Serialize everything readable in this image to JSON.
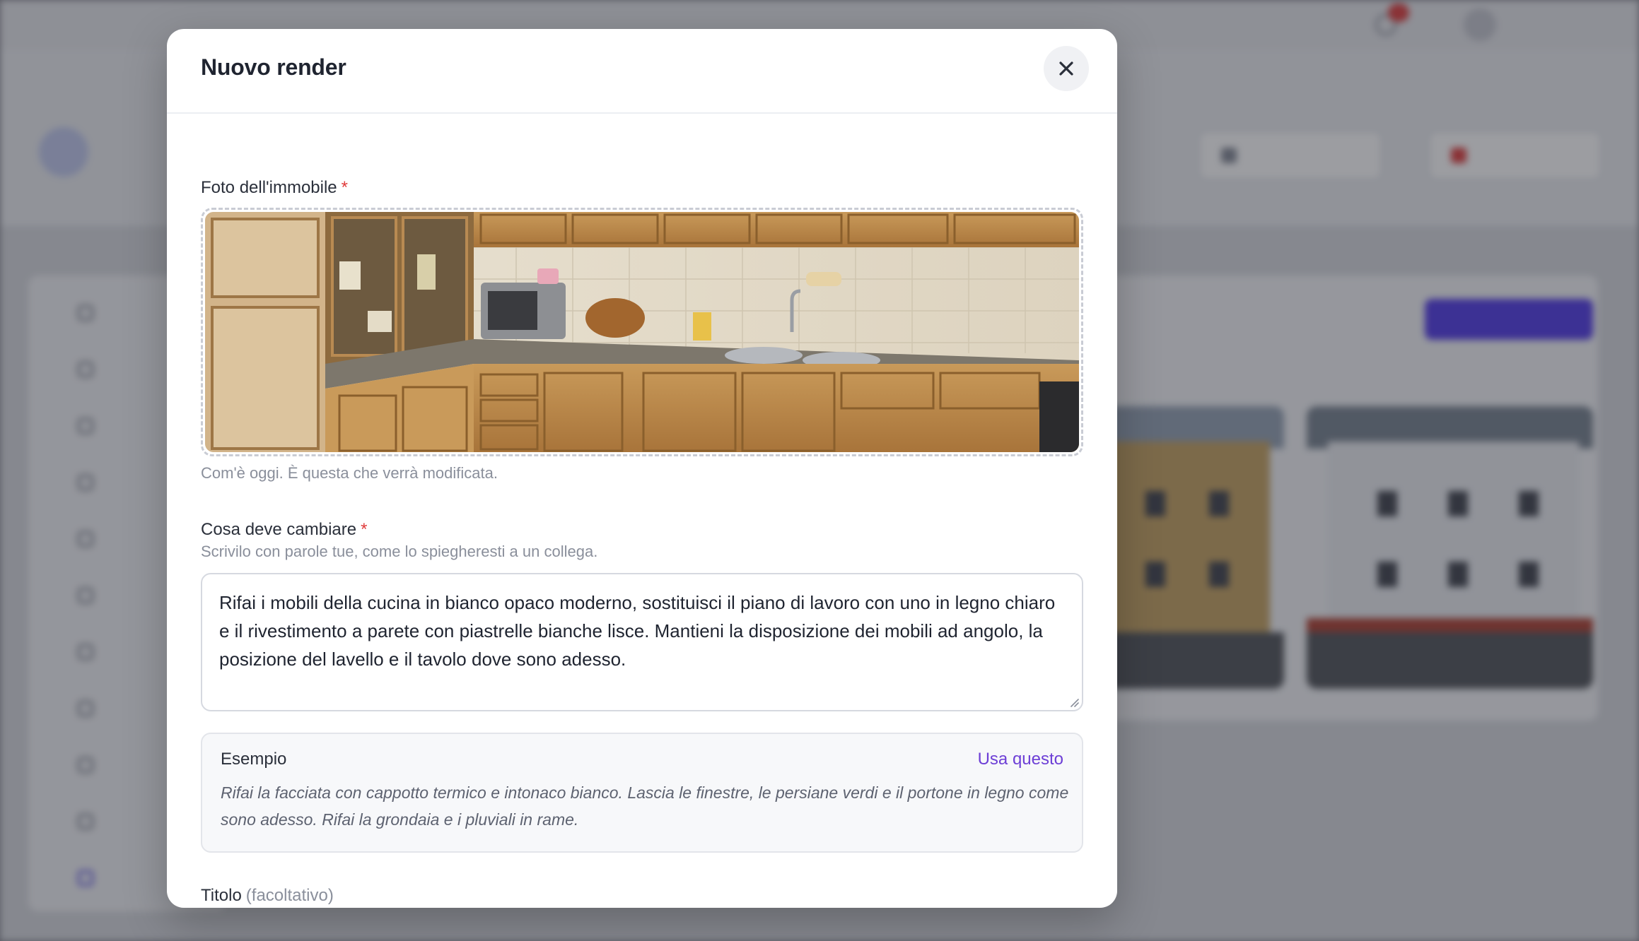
{
  "modal": {
    "title": "Nuovo render",
    "close_icon": "close-icon",
    "photo": {
      "label": "Foto dell'immobile",
      "required_mark": "*",
      "help": "Com'è oggi. È questa che verrà modificata."
    },
    "changes": {
      "label": "Cosa deve cambiare",
      "required_mark": "*",
      "help": "Scrivilo con parole tue, come lo spiegheresti a un collega.",
      "value": "Rifai i mobili della cucina in bianco opaco moderno, sostituisci il piano di lavoro con uno in legno chiaro e il rivestimento a parete con piastrelle bianche lisce. Mantieni la disposizione dei mobili ad angolo, la posizione del lavello e il tavolo dove sono adesso."
    },
    "example": {
      "title": "Esempio",
      "use_label": "Usa questo",
      "text": "Rifai la facciata con cappotto termico e intonaco bianco. Lascia le finestre, le persiane verdi e il portone in legno come sono adesso. Rifai la grondaia e i pluviali in rame."
    },
    "title_field": {
      "label": "Titolo",
      "optional": "(facoltativo)",
      "value": ""
    }
  },
  "colors": {
    "accent": "#6d3fd6",
    "required": "#e03b3b",
    "overlay": "rgba(20,22,30,0.42)"
  }
}
